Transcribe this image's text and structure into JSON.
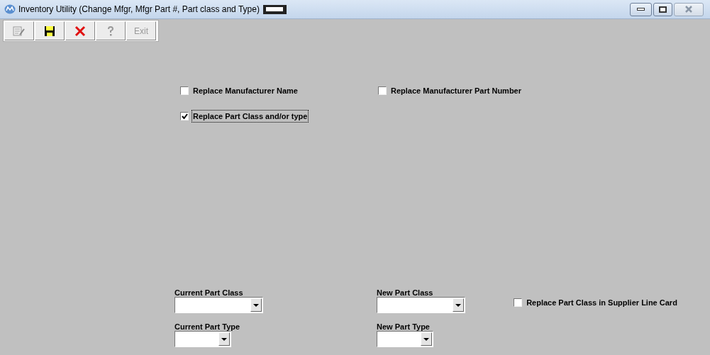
{
  "window": {
    "title": "Inventory Utility (Change Mfgr, Mfgr Part #, Part class and Type)"
  },
  "toolbar": [
    {
      "kind": "edit",
      "disabled": true
    },
    {
      "kind": "save",
      "disabled": false
    },
    {
      "kind": "delete",
      "disabled": false
    },
    {
      "kind": "help",
      "disabled": true
    },
    {
      "kind": "exit",
      "label": "Exit",
      "disabled": true
    }
  ],
  "options": [
    {
      "label": "Replace Manufacturer Name",
      "checked": false,
      "focused": false
    },
    {
      "label": "Replace Manufacturer Part Number",
      "checked": false,
      "focused": false
    },
    {
      "label": "Replace Part Class and/or type",
      "checked": true,
      "focused": true
    }
  ],
  "part_fields": [
    {
      "label": "Current Part Class"
    },
    {
      "label": "New Part Class"
    },
    {
      "label": "Current Part Type"
    },
    {
      "label": "New Part Type"
    }
  ],
  "supplier_option": {
    "label": "Replace Part Class in Supplier Line Card",
    "checked": false
  }
}
